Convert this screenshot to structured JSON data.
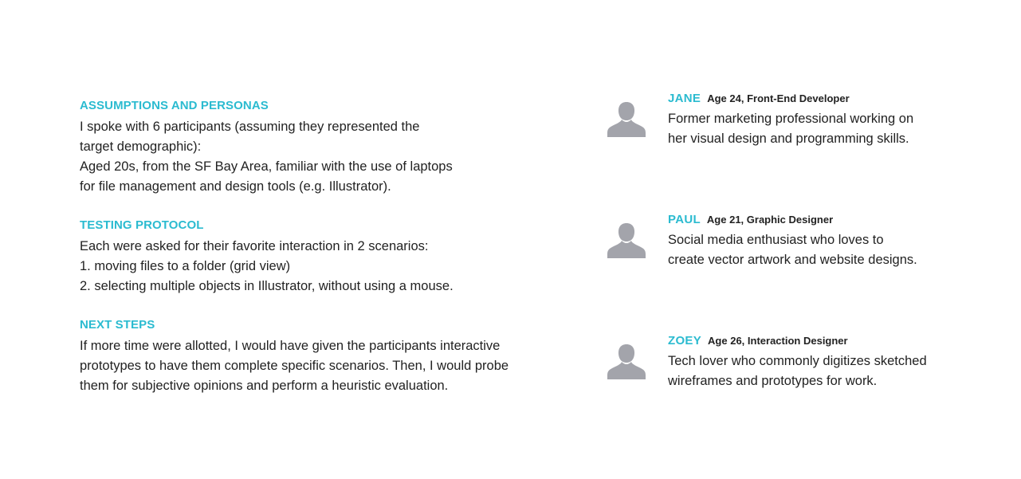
{
  "sections": [
    {
      "title": "ASSUMPTIONS AND PERSONAS",
      "lines": [
        "I spoke with 6 participants (assuming they represented the",
        "target demographic):",
        "Aged 20s, from the SF Bay Area, familiar with the use of laptops",
        "for file management and design tools (e.g. Illustrator)."
      ]
    },
    {
      "title": "TESTING PROTOCOL",
      "lines": [
        "Each were asked for their favorite interaction in 2 scenarios:",
        "1. moving files to a folder (grid view)",
        "2. selecting multiple objects in Illustrator, without using a mouse."
      ]
    },
    {
      "title": "NEXT STEPS",
      "lines": [
        "If more time were allotted, I would have given the participants interactive",
        "prototypes to have them complete specific scenarios. Then, I would probe",
        "them for subjective opinions and perform a heuristic evaluation."
      ]
    }
  ],
  "personas": [
    {
      "name": "JANE",
      "meta": "Age 24, Front-End Developer",
      "lines": [
        "Former marketing professional working on",
        "her visual design and programming skills."
      ],
      "icon": "user-silhouette-icon"
    },
    {
      "name": "PAUL",
      "meta": "Age 21, Graphic Designer",
      "lines": [
        "Social media enthusiast who loves to",
        "create vector artwork and website designs."
      ],
      "icon": "user-silhouette-icon"
    },
    {
      "name": "ZOEY",
      "meta": "Age 26, Interaction Designer",
      "lines": [
        "Tech lover who commonly digitizes sketched",
        "wireframes and prototypes for work."
      ],
      "icon": "user-silhouette-icon"
    }
  ],
  "colors": {
    "accent": "#2bbbd0",
    "text": "#222222",
    "avatar": "#a3a4ab",
    "background": "#ffffff"
  }
}
